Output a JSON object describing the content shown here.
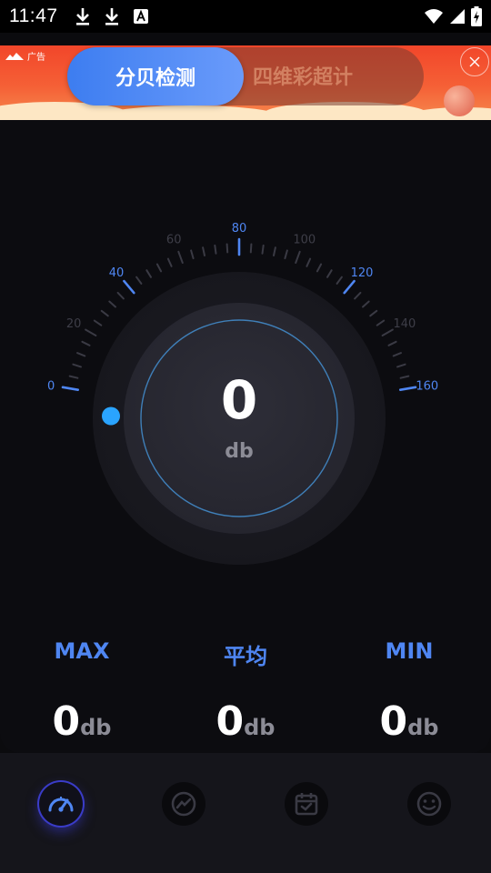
{
  "status_bar": {
    "time": "11:47"
  },
  "ad": {
    "tag": "广告",
    "button_label": "分贝检测",
    "alt_text": "四维彩超计"
  },
  "meter": {
    "value": "0",
    "unit": "db",
    "accent_color": "#4f86f2",
    "indicator_color": "#2aa4ff",
    "scale_min": 0,
    "scale_max": 160,
    "current_level": 0,
    "tick_labels": [
      "0",
      "20",
      "40",
      "60",
      "80",
      "100",
      "120",
      "140",
      "160"
    ]
  },
  "stats": [
    {
      "label": "MAX",
      "value": "0",
      "unit": "db"
    },
    {
      "label": "平均",
      "value": "0",
      "unit": "db"
    },
    {
      "label": "MIN",
      "value": "0",
      "unit": "db"
    }
  ],
  "nav": [
    {
      "icon": "speedometer-icon",
      "active": true
    },
    {
      "icon": "trend-chart-icon",
      "active": false
    },
    {
      "icon": "calendar-check-icon",
      "active": false
    },
    {
      "icon": "smiley-icon",
      "active": false
    }
  ]
}
